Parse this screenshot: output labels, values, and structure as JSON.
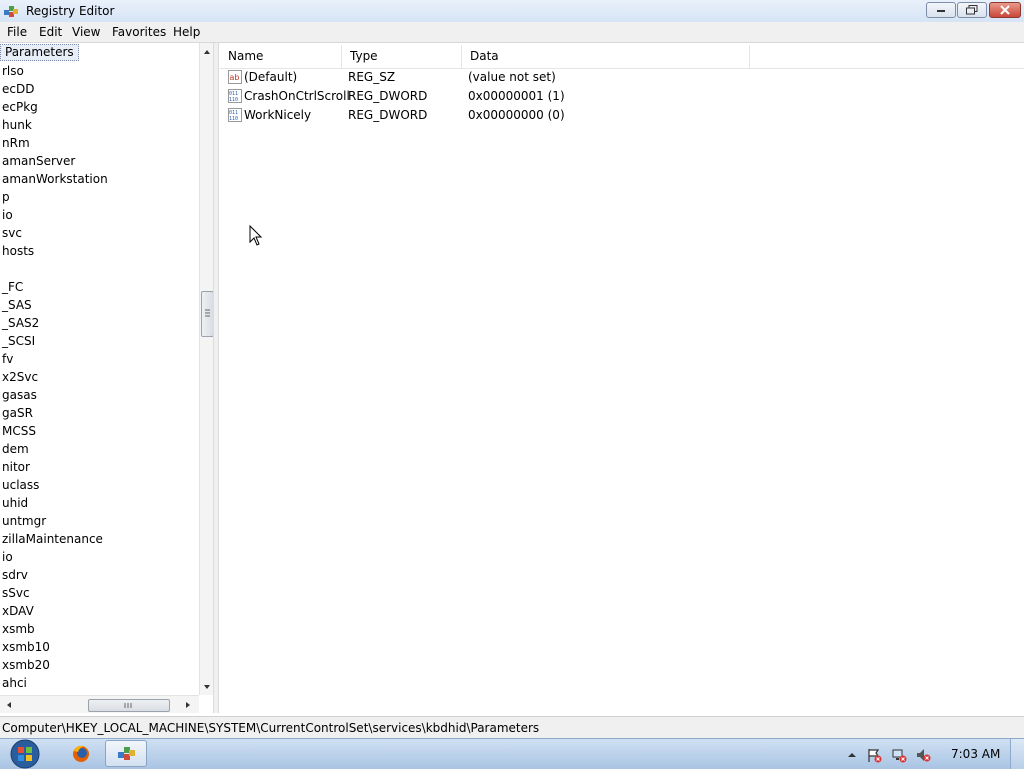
{
  "window": {
    "title": "Registry Editor",
    "buttons": [
      "minimize-icon",
      "maximize-icon",
      "close-icon"
    ]
  },
  "menu": [
    "File",
    "Edit",
    "View",
    "Favorites",
    "Help"
  ],
  "tree": {
    "selected": "Parameters",
    "items": [
      "rlso",
      "ecDD",
      "ecPkg",
      "hunk",
      "nRm",
      "amanServer",
      "amanWorkstation",
      "p",
      "io",
      "svc",
      "hosts",
      "",
      "_FC",
      "_SAS",
      "_SAS2",
      "_SCSI",
      "fv",
      "x2Svc",
      "gasas",
      "gaSR",
      "MCSS",
      "dem",
      "nitor",
      "uclass",
      "uhid",
      "untmgr",
      "zillaMaintenance",
      "io",
      "sdrv",
      "sSvc",
      "xDAV",
      "xsmb",
      "xsmb10",
      "xsmb20",
      "ahci"
    ]
  },
  "list": {
    "columns": [
      "Name",
      "Type",
      "Data"
    ],
    "rows": [
      {
        "name": "(Default)",
        "type": "REG_SZ",
        "data": "(value not set)",
        "icon": "string-value-icon"
      },
      {
        "name": "CrashOnCtrlScroll",
        "type": "REG_DWORD",
        "data": "0x00000001 (1)",
        "icon": "dword-value-icon"
      },
      {
        "name": "WorkNicely",
        "type": "REG_DWORD",
        "data": "0x00000000 (0)",
        "icon": "dword-value-icon"
      }
    ]
  },
  "status": {
    "path": "Computer\\HKEY_LOCAL_MACHINE\\SYSTEM\\CurrentControlSet\\services\\kbdhid\\Parameters"
  },
  "taskbar": {
    "clock": "7:03 AM",
    "apps": [
      "firefox-icon",
      "regedit-icon"
    ]
  },
  "colors": {
    "titlebar": "#d6e4f5",
    "close_button": "#c9483a",
    "taskbar": "#a9c4e3"
  }
}
